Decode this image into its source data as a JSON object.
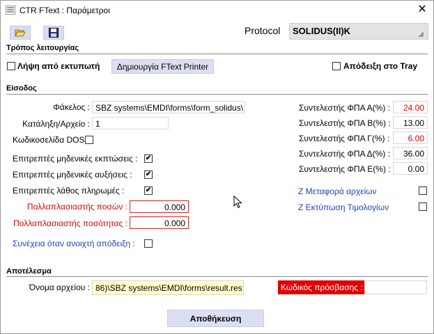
{
  "window": {
    "title": "CTR FText : Παράμετροι",
    "close": "✕"
  },
  "toolbar": {
    "open_icon": "folder-open-icon",
    "save_icon": "save-icon"
  },
  "protocol": {
    "label": "Protocol",
    "value": "SOLIDUS(II)K"
  },
  "mode": {
    "section_title": "Τρόπος λειτουργίας",
    "capture_label": "Λήψη από εκτυπωτή",
    "capture_checked": false,
    "create_button": "Δημιουργία FText Printer",
    "tray_label": "Απόδειξη στο Tray",
    "tray_checked": false
  },
  "input": {
    "section_title": "Είσοδος",
    "folder_label": "Φάκελος :",
    "folder_value": "SBZ systems\\EMDI\\forms\\form_solidus\\",
    "ext_label": "Κατάληξη/Αρχείο :",
    "ext_value": "1",
    "dos_label": "Κωδικοσελίδα DOS",
    "dos_checked": false,
    "zero_disc_label": "Επιτρεπτές μηδενικές εκπτώσεις :",
    "zero_disc_checked": true,
    "zero_inc_label": "Επιτρεπτές μηδενικές αυξήσεις :",
    "zero_inc_checked": true,
    "wrong_pay_label": "Επιτρεπτές λάθος πληρωμές :",
    "wrong_pay_checked": true,
    "amount_mult_label": "Πολλαπλασιαστής ποσών :",
    "amount_mult_value": "0.000",
    "qty_mult_label": "Πολλαπλασιαστής ποσότητας :",
    "qty_mult_value": "0.000",
    "continue_label": "Συνέχεια όταν ανοιχτή απόδειξη :",
    "continue_checked": false,
    "vat": [
      {
        "label": "Συντελεστής ΦΠΑ Α(%) :",
        "value": "24.00",
        "red": true
      },
      {
        "label": "Συντελεστής ΦΠΑ Β(%) :",
        "value": "13.00",
        "red": false
      },
      {
        "label": "Συντελεστής ΦΠΑ Γ(%) :",
        "value": "6.00",
        "red": true
      },
      {
        "label": "Συντελεστής ΦΠΑ Δ(%) :",
        "value": "36.00",
        "red": false
      },
      {
        "label": "Συντελεστής ΦΠΑ Ε(%) :",
        "value": "0.00",
        "red": false
      }
    ],
    "z_transfer_label": "Z Μεταφορά αρχείων",
    "z_transfer_checked": false,
    "z_print_label": "Z Εκτύπωση Τιμολογίων",
    "z_print_checked": false
  },
  "result": {
    "section_title": "Αποτέλεσμα",
    "filename_label": "Όνομα αρχείου :",
    "filename_value": "86)\\SBZ systems\\EMDI\\forms\\result.res",
    "password_label": "Κωδικός πρόσβασης :",
    "password_value": ""
  },
  "footer": {
    "save_button": "Αποθήκευση"
  },
  "colors": {
    "accent_blue": "#1f3fbf",
    "warning_red": "#e00000",
    "button_bg": "#dcdff2",
    "yellow_field": "#ffffcc"
  }
}
